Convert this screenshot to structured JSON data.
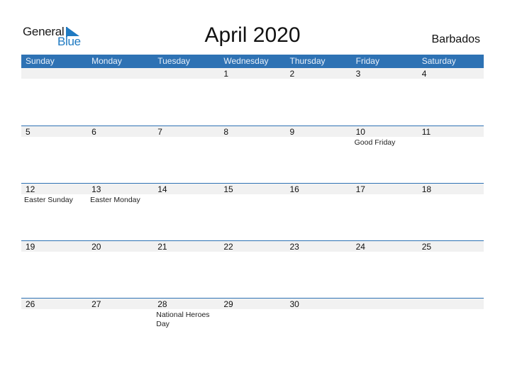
{
  "logo": {
    "line1": "General",
    "line2": "Blue"
  },
  "title": "April 2020",
  "country": "Barbados",
  "weekdays": [
    "Sunday",
    "Monday",
    "Tuesday",
    "Wednesday",
    "Thursday",
    "Friday",
    "Saturday"
  ],
  "weeks": [
    [
      {
        "d": ""
      },
      {
        "d": ""
      },
      {
        "d": ""
      },
      {
        "d": "1"
      },
      {
        "d": "2"
      },
      {
        "d": "3"
      },
      {
        "d": "4"
      }
    ],
    [
      {
        "d": "5"
      },
      {
        "d": "6"
      },
      {
        "d": "7"
      },
      {
        "d": "8"
      },
      {
        "d": "9"
      },
      {
        "d": "10",
        "e": "Good Friday"
      },
      {
        "d": "11"
      }
    ],
    [
      {
        "d": "12",
        "e": "Easter Sunday"
      },
      {
        "d": "13",
        "e": "Easter Monday"
      },
      {
        "d": "14"
      },
      {
        "d": "15"
      },
      {
        "d": "16"
      },
      {
        "d": "17"
      },
      {
        "d": "18"
      }
    ],
    [
      {
        "d": "19"
      },
      {
        "d": "20"
      },
      {
        "d": "21"
      },
      {
        "d": "22"
      },
      {
        "d": "23"
      },
      {
        "d": "24"
      },
      {
        "d": "25"
      }
    ],
    [
      {
        "d": "26"
      },
      {
        "d": "27"
      },
      {
        "d": "28",
        "e": "National Heroes Day"
      },
      {
        "d": "29"
      },
      {
        "d": "30"
      },
      {
        "d": ""
      },
      {
        "d": ""
      }
    ]
  ],
  "colors": {
    "accent": "#2e72b4",
    "logo_blue": "#1f7ac2",
    "band": "#f1f1f1"
  }
}
